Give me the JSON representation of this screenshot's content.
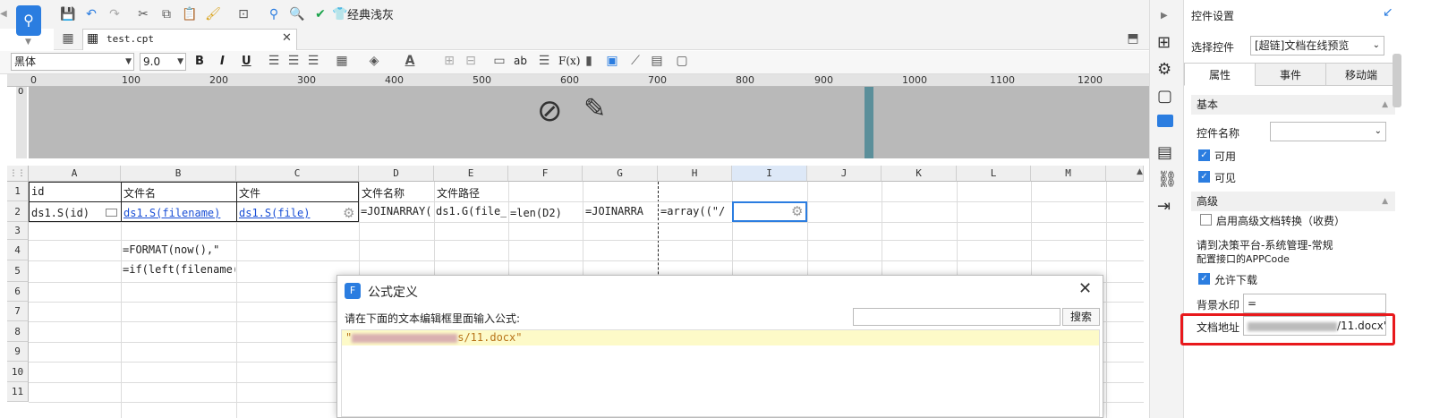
{
  "toolbar": {
    "style_button": "经典浅灰"
  },
  "tab": {
    "label": "test.cpt"
  },
  "format": {
    "font": "黑体",
    "size": "9.0",
    "bold": "B",
    "italic": "I",
    "underline": "U",
    "formula_label": "F(x)",
    "ab_label": "ab"
  },
  "ruler": {
    "ticks": [
      "0",
      "100",
      "200",
      "300",
      "400",
      "500",
      "600",
      "700",
      "800",
      "900",
      "1000",
      "1100",
      "1200"
    ],
    "vertical_start": "0"
  },
  "grid": {
    "columns": [
      "A",
      "B",
      "C",
      "D",
      "E",
      "F",
      "G",
      "H",
      "I",
      "J",
      "K",
      "L",
      "M"
    ],
    "rows": [
      "1",
      "2",
      "3",
      "4",
      "5",
      "6",
      "7",
      "8",
      "9",
      "10",
      "11"
    ],
    "cells": {
      "A1": "id",
      "B1": "文件名",
      "C1": "文件",
      "D1": "文件名称",
      "E1": "文件路径",
      "A2": "ds1.S(id)",
      "B2": "ds1.S(filename)",
      "C2": "ds1.S(file)",
      "D2": "=JOINARRAY(",
      "E2": "ds1.G(file_",
      "F2": "=len(D2)",
      "G2": "=JOINARRA",
      "H2": "=array((\"/",
      "B4": "=FORMAT(now(),\"",
      "B5": "=if(left(filename("
    }
  },
  "panel": {
    "title": "控件设置",
    "select_label": "选择控件",
    "select_value": "[超链]文档在线预览",
    "tabs": [
      "属性",
      "事件",
      "移动端"
    ],
    "basic_section": "基本",
    "name_label": "控件名称",
    "name_value": "",
    "enabled_label": "可用",
    "visible_label": "可见",
    "advanced_section": "高级",
    "advanced_conversion": "启用高级文档转换（收费）",
    "appcode_note_line1": "请到决策平台-系统管理-常规",
    "appcode_note_line2": "配置接口的APPCode",
    "allow_download": "允许下载",
    "watermark_label": "背景水印",
    "watermark_value": "=",
    "address_label": "文档地址",
    "address_value": "/11.docx\""
  },
  "dialog": {
    "title": "公式定义",
    "prompt": "请在下面的文本编辑框里面输入公式:",
    "search_button": "搜索",
    "search_value": "",
    "formula_prefix": "\"",
    "formula_suffix": "s/11.docx\""
  },
  "colors": {
    "accent": "#2b7de0",
    "highlight_red": "#e8191c",
    "link": "#1a4fd6"
  }
}
